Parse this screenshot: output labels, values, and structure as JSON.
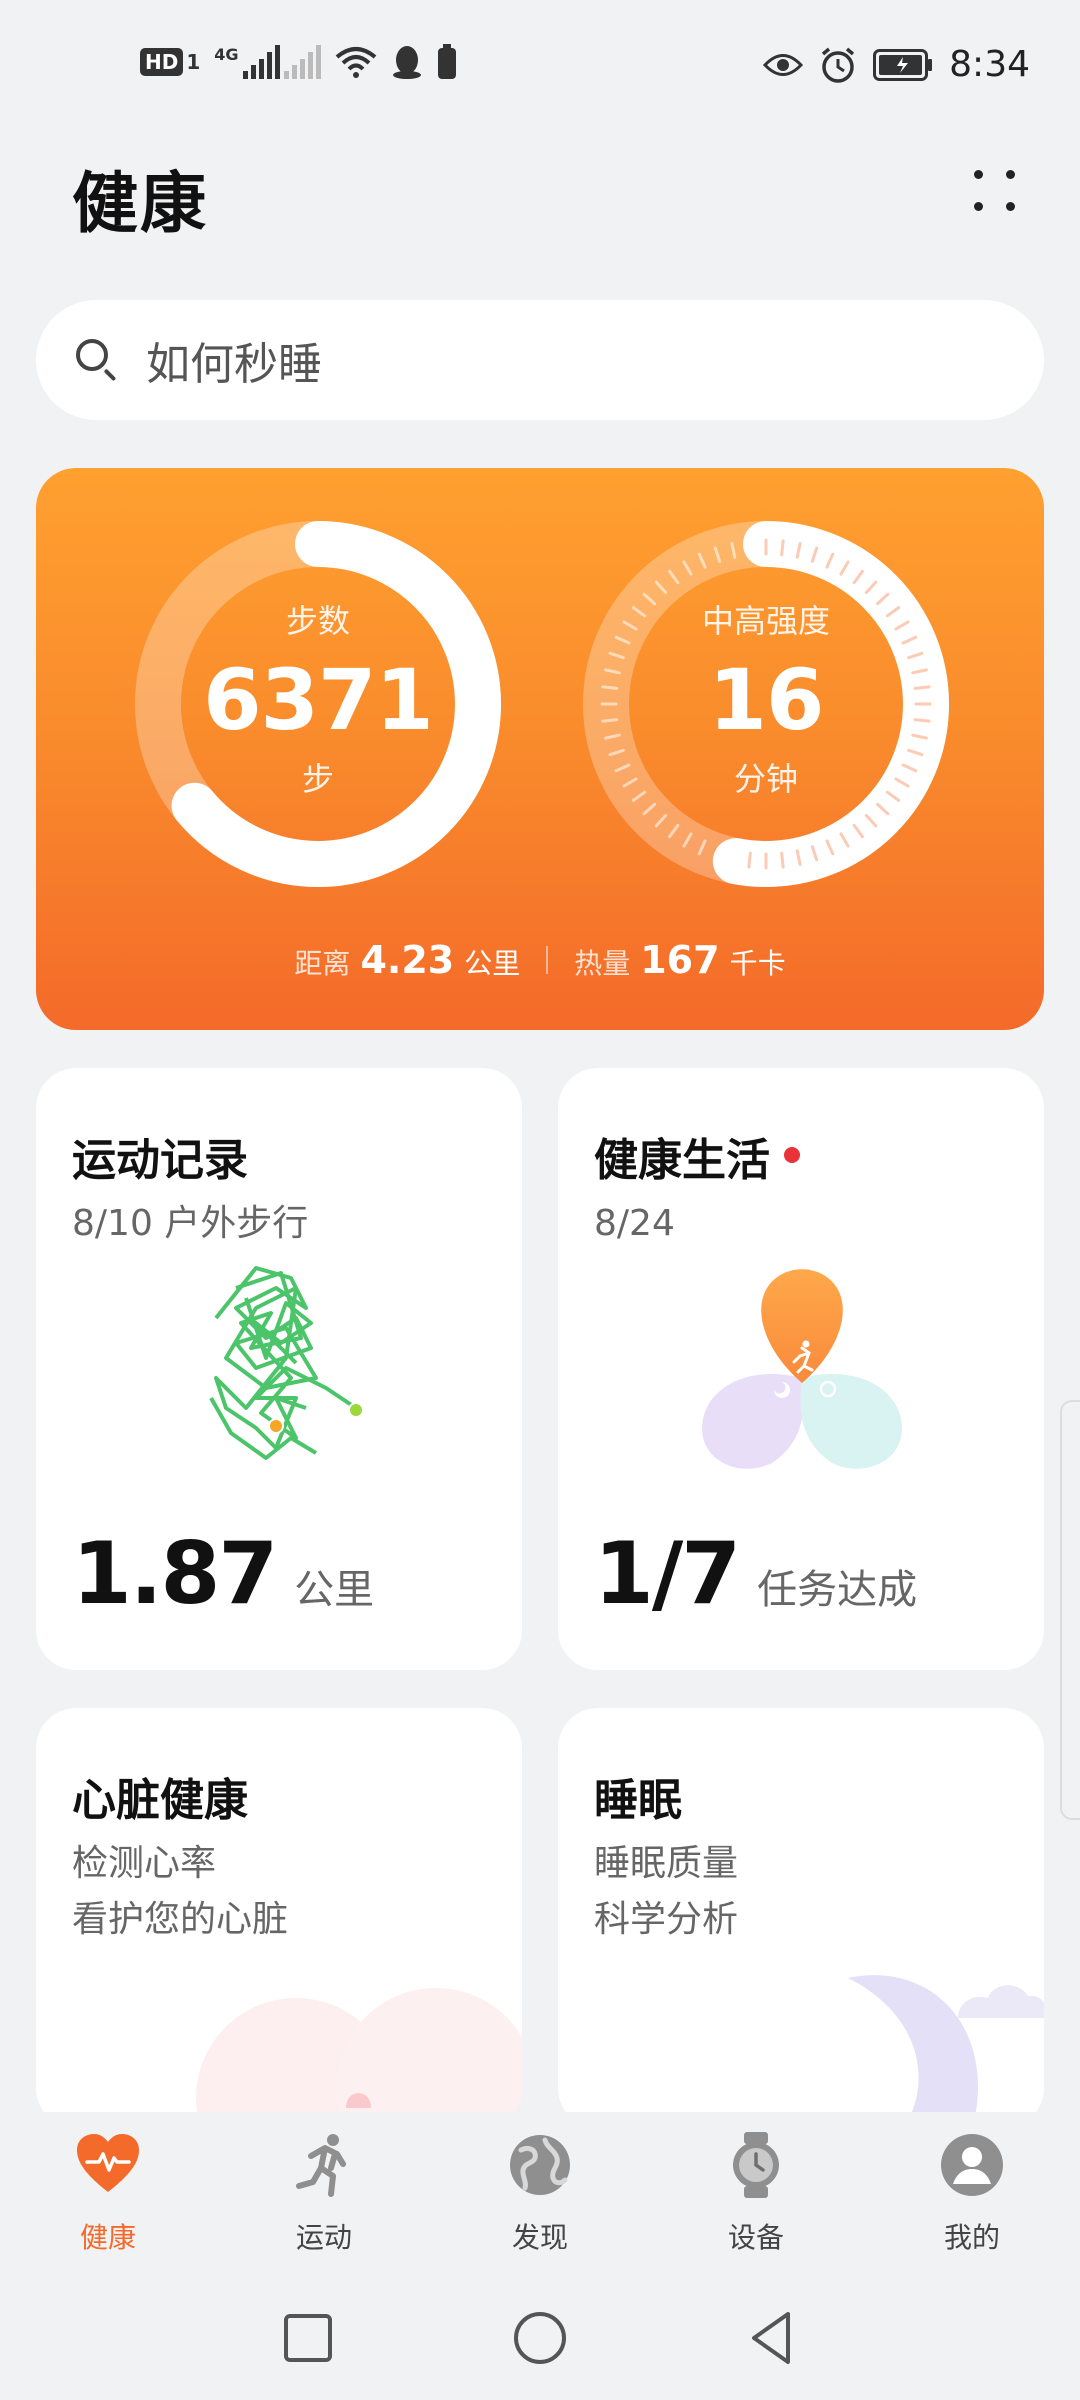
{
  "status_bar": {
    "hd_label": "HD",
    "sim1": "1",
    "net_label": "4G",
    "time": "8:34",
    "icons": [
      "hd-icon",
      "signal-icon",
      "wifi-icon",
      "qq-icon",
      "battery-small-icon",
      "eye-icon",
      "alarm-icon",
      "battery-icon"
    ]
  },
  "header": {
    "title": "健康",
    "more_icon": "more-dots-icon"
  },
  "search": {
    "placeholder": "如何秒睡",
    "icon": "search-icon"
  },
  "activity": {
    "steps": {
      "label": "步数",
      "value": "6371",
      "unit": "步",
      "progress": 0.64
    },
    "intensity": {
      "label": "中高强度",
      "value": "16",
      "unit": "分钟",
      "progress": 0.53
    },
    "distance_label": "距离",
    "distance_value": "4.23",
    "distance_unit": "公里",
    "calories_label": "热量",
    "calories_value": "167",
    "calories_unit": "千卡",
    "colors": {
      "top": "#ffa030",
      "bottom": "#f46a2a"
    }
  },
  "cards": {
    "exercise": {
      "title": "运动记录",
      "subtitle": "8/10 户外步行",
      "value": "1.87",
      "unit": "公里"
    },
    "healthy_life": {
      "title": "健康生活",
      "subtitle": "8/24",
      "value": "1/7",
      "unit": "任务达成",
      "has_badge": true
    },
    "heart": {
      "title": "心脏健康",
      "line1": "检测心率",
      "line2": "看护您的心脏"
    },
    "sleep": {
      "title": "睡眠",
      "line1": "睡眠质量",
      "line2": "科学分析"
    }
  },
  "bottom_nav": [
    {
      "label": "健康",
      "icon": "heart-icon",
      "active": true
    },
    {
      "label": "运动",
      "icon": "running-icon",
      "active": false
    },
    {
      "label": "发现",
      "icon": "globe-icon",
      "active": false
    },
    {
      "label": "设备",
      "icon": "watch-icon",
      "active": false
    },
    {
      "label": "我的",
      "icon": "profile-icon",
      "active": false
    }
  ],
  "system_nav": [
    "recent-apps-icon",
    "home-icon",
    "back-icon"
  ]
}
